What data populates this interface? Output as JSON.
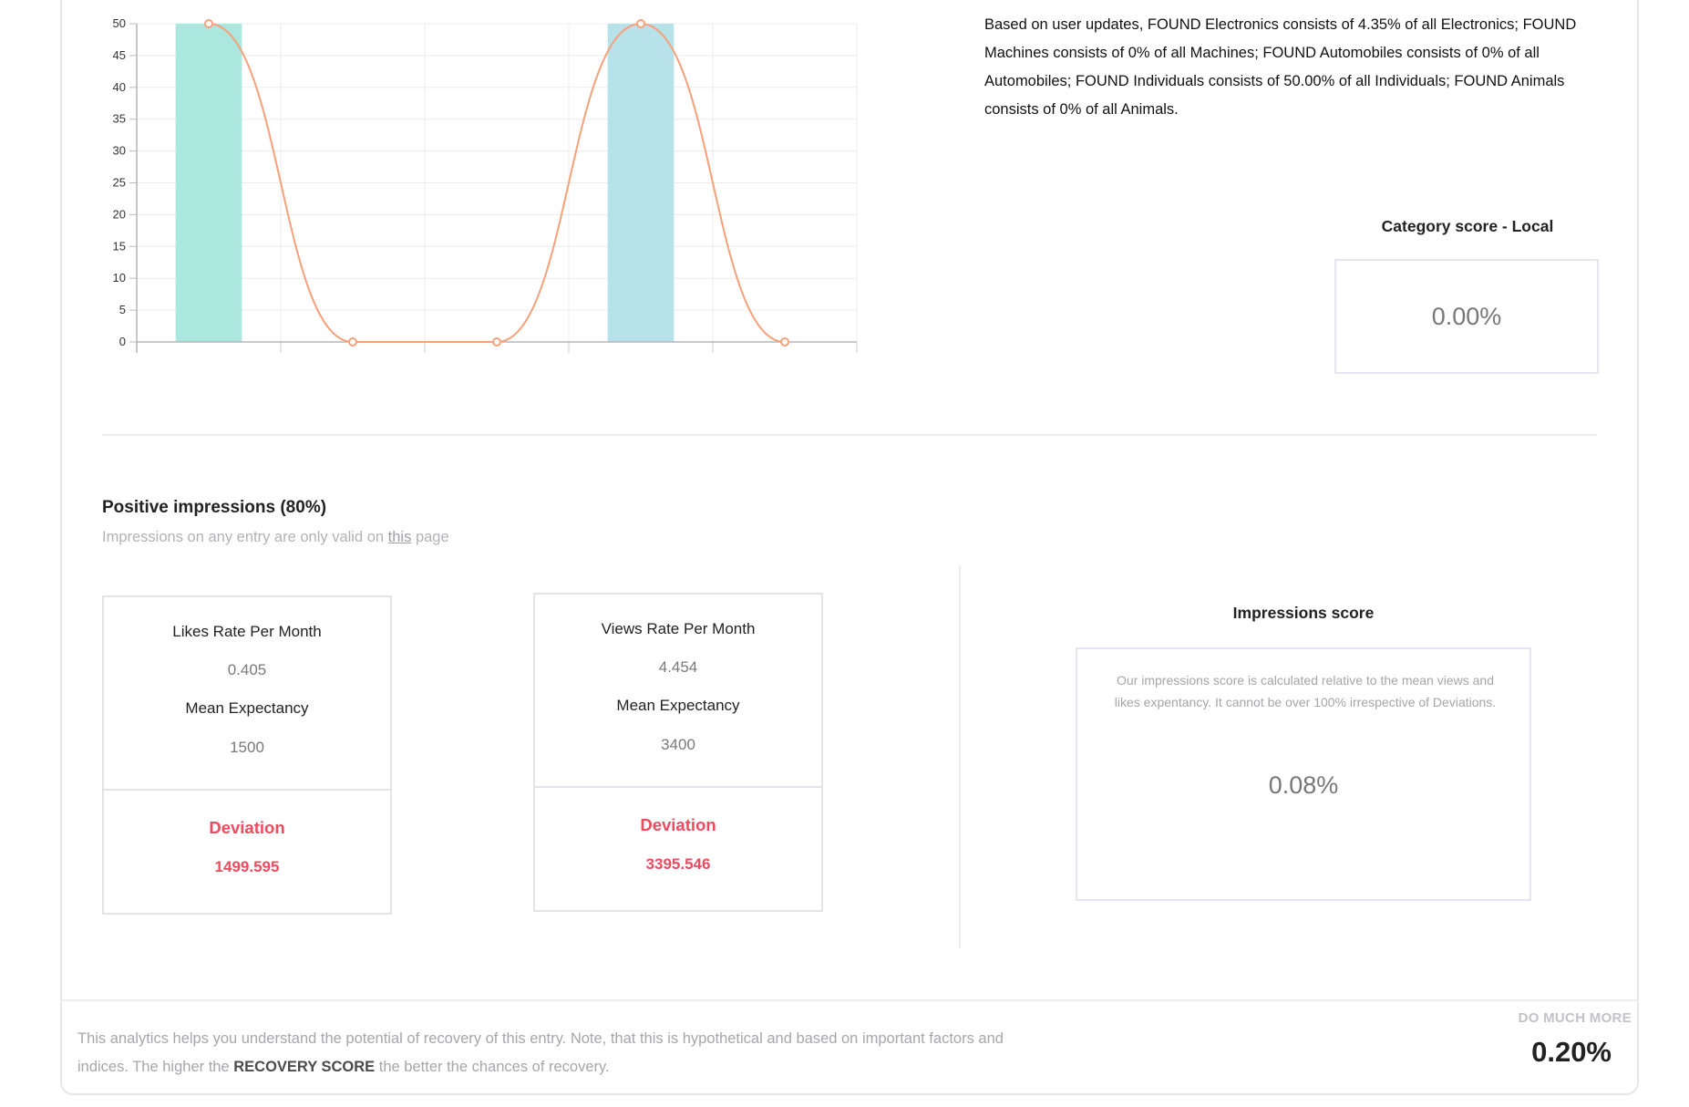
{
  "chart_data": {
    "type": "bar+line",
    "categories": [
      "",
      "",
      "",
      "",
      ""
    ],
    "ylim": [
      0,
      50
    ],
    "yticks": [
      0,
      5,
      10,
      15,
      20,
      25,
      30,
      35,
      40,
      45,
      50
    ],
    "grid": true,
    "series": [
      {
        "type": "bar",
        "values": [
          50,
          0,
          0,
          50,
          0
        ],
        "colors": [
          "#abe7de",
          "#abe7de",
          "#abe7de",
          "#b7e2ea",
          "#abe7de"
        ]
      },
      {
        "type": "line",
        "values": [
          50,
          0,
          0,
          50,
          0
        ],
        "color": "#f7a07a"
      }
    ]
  },
  "summary": {
    "text": "Based on user updates, FOUND Electronics consists of 4.35% of all Electronics; FOUND Machines consists of 0% of all Machines; FOUND Automobiles consists of 0% of all Automobiles; FOUND Individuals consists of 50.00% of all Individuals; FOUND Animals consists of 0% of all Animals."
  },
  "category_score": {
    "title": "Category score - Local",
    "value": "0.00%"
  },
  "impressions": {
    "heading": "Positive impressions (80%)",
    "subtitle_before": "Impressions on any entry are only valid on ",
    "subtitle_link": "this",
    "subtitle_after": " page",
    "likes": {
      "rate_label": "Likes Rate Per Month",
      "rate_value": "0.405",
      "mean_label": "Mean Expectancy",
      "mean_value": "1500",
      "deviation_label": "Deviation",
      "deviation_value": "1499.595"
    },
    "views": {
      "rate_label": "Views Rate Per Month",
      "rate_value": "4.454",
      "mean_label": "Mean Expectancy",
      "mean_value": "3400",
      "deviation_label": "Deviation",
      "deviation_value": "3395.546"
    },
    "score_title": "Impressions score",
    "score_description": "Our impressions score is calculated relative to the mean views and likes expentancy. It cannot be over 100% irrespective of Deviations.",
    "score_value": "0.08%"
  },
  "footer": {
    "text_before": "This analytics helps you understand the potential of recovery of this entry. Note, that this is hypothetical and based on important factors and indices. The higher the ",
    "text_strong": "RECOVERY SCORE",
    "text_after": " the better the chances of recovery.",
    "more_label": "DO MUCH MORE",
    "total_score": "0.20%"
  }
}
